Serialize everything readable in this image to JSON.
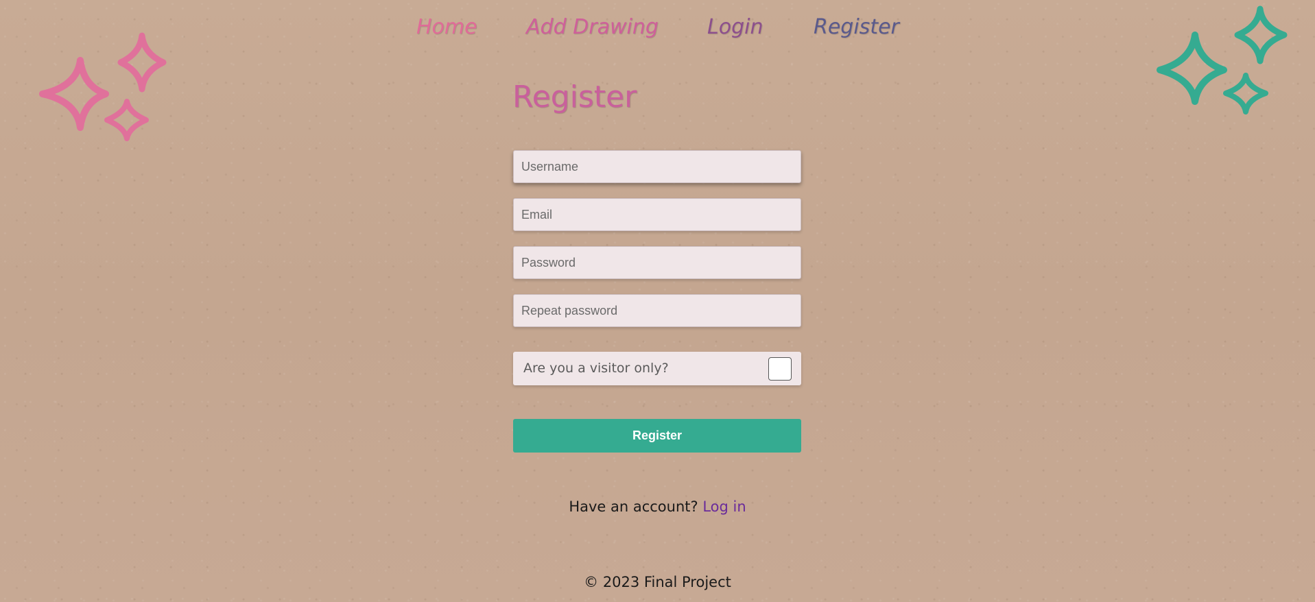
{
  "nav": {
    "items": [
      {
        "label": "Home"
      },
      {
        "label": "Add Drawing"
      },
      {
        "label": "Login"
      },
      {
        "label": "Register"
      }
    ]
  },
  "page": {
    "title": "Register"
  },
  "form": {
    "username": {
      "placeholder": "Username",
      "value": ""
    },
    "email": {
      "placeholder": "Email",
      "value": ""
    },
    "password": {
      "placeholder": "Password",
      "value": ""
    },
    "repeat_password": {
      "placeholder": "Repeat password",
      "value": ""
    },
    "visitor": {
      "label": "Are you a visitor only?",
      "checked": false
    },
    "submit_label": "Register"
  },
  "account": {
    "prompt": "Have an account?",
    "link_label": "Log in"
  },
  "footer": {
    "text": "© 2023 Final Project"
  },
  "colors": {
    "accent_green": "#35ab91",
    "pink": "#e06b98",
    "purple_link": "#6a2b9a",
    "background": "#c6a892"
  },
  "decorations": {
    "left": "pink-sparkles-icon",
    "right": "green-sparkles-icon"
  }
}
